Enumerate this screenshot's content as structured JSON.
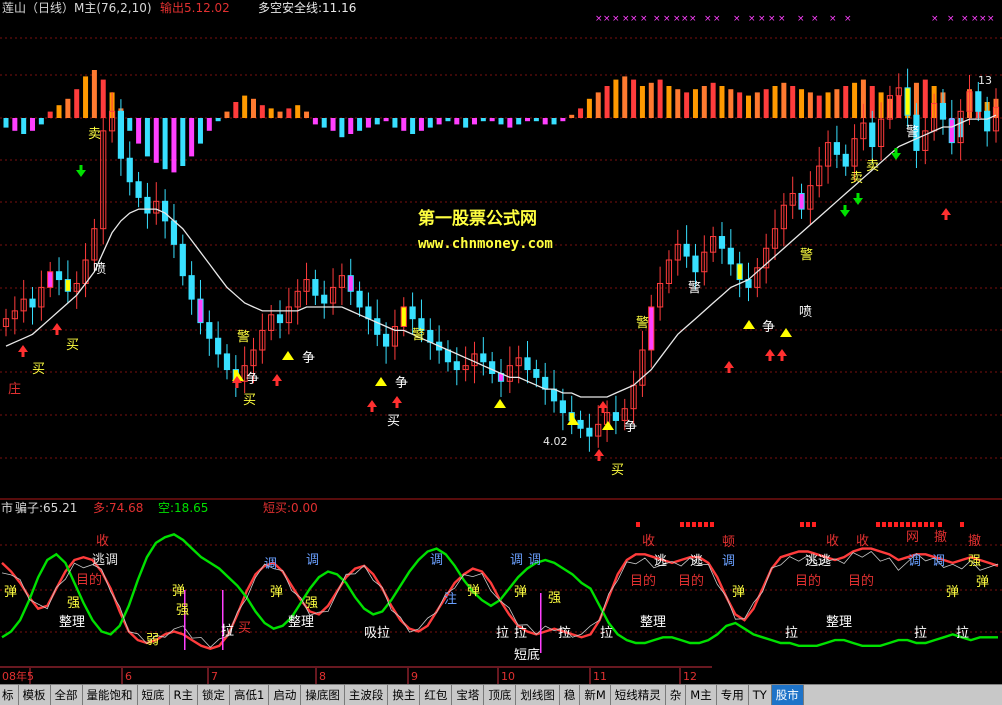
{
  "colors": {
    "bg": "#000000",
    "grid_red": "#7a1010",
    "up_red": "#ff3c3c",
    "down_cyan": "#38e0ff",
    "ma_white": "#e8e8e8",
    "yellow": "#ffff00",
    "magenta": "#ff40ff",
    "green": "#00e000",
    "orange": "#ff9a00",
    "label_red": "#e03030",
    "label_yellow": "#ffff40",
    "label_blue": "#6aa0ff"
  },
  "header": {
    "title": "莲山（日线）M主(76,2,10)",
    "output": "输出5.12.02",
    "safety_line": "多空安全线:11.16"
  },
  "watermark": {
    "line1": "第一股票公式网",
    "line2": "www.chnmoney.com"
  },
  "lower_header": {
    "name": "市",
    "v1": "骗子:65.21",
    "v2": "多:74.68",
    "v3": "空:18.65",
    "v4": "短买:0.00"
  },
  "price_labels": {
    "high": "13",
    "low": "4.02"
  },
  "chart_data": [
    {
      "type": "candlestick",
      "title": "莲山（日线）M主(76,2,10)",
      "close": [
        7.1,
        7.3,
        7.6,
        7.4,
        7.9,
        8.3,
        8.1,
        7.8,
        8.0,
        8.6,
        9.4,
        11.9,
        12.4,
        11.2,
        10.6,
        10.2,
        9.8,
        10.1,
        9.6,
        9.0,
        8.2,
        7.6,
        7.0,
        6.6,
        6.2,
        5.8,
        5.5,
        5.9,
        6.3,
        6.8,
        7.2,
        7.0,
        7.4,
        7.8,
        8.1,
        7.7,
        7.5,
        7.9,
        8.2,
        7.8,
        7.4,
        7.1,
        6.7,
        6.4,
        6.9,
        7.4,
        7.1,
        6.8,
        6.5,
        6.3,
        6.0,
        5.8,
        5.9,
        6.2,
        6.0,
        5.7,
        5.5,
        5.9,
        6.1,
        5.8,
        5.6,
        5.3,
        5.0,
        4.7,
        4.5,
        4.3,
        4.1,
        4.4,
        4.7,
        4.5,
        4.8,
        5.4,
        6.3,
        7.4,
        8.0,
        8.6,
        9.0,
        8.7,
        8.3,
        8.8,
        9.2,
        8.9,
        8.5,
        8.1,
        7.9,
        8.4,
        8.9,
        9.4,
        10.0,
        10.3,
        9.9,
        10.5,
        11.0,
        11.6,
        11.3,
        11.0,
        11.7,
        12.1,
        11.5,
        12.2,
        12.8,
        13.0,
        12.3,
        11.4,
        11.9,
        12.6,
        12.2,
        11.6,
        12.4,
        12.9,
        12.4,
        11.9,
        12.5
      ],
      "ma_safety_line": [
        6.4,
        6.5,
        6.6,
        6.7,
        6.9,
        7.1,
        7.3,
        7.5,
        7.7,
        8.0,
        8.3,
        8.8,
        9.3,
        9.6,
        9.8,
        9.9,
        9.9,
        9.9,
        9.8,
        9.6,
        9.4,
        9.1,
        8.8,
        8.5,
        8.2,
        7.9,
        7.7,
        7.5,
        7.4,
        7.3,
        7.3,
        7.3,
        7.3,
        7.3,
        7.4,
        7.4,
        7.4,
        7.4,
        7.4,
        7.3,
        7.2,
        7.1,
        7.0,
        6.9,
        6.8,
        6.8,
        6.7,
        6.6,
        6.5,
        6.4,
        6.3,
        6.2,
        6.1,
        6.0,
        5.9,
        5.8,
        5.7,
        5.6,
        5.6,
        5.5,
        5.4,
        5.3,
        5.3,
        5.2,
        5.2,
        5.1,
        5.1,
        5.1,
        5.1,
        5.2,
        5.3,
        5.4,
        5.6,
        5.8,
        6.1,
        6.4,
        6.7,
        6.9,
        7.1,
        7.3,
        7.5,
        7.7,
        7.9,
        8.0,
        8.1,
        8.3,
        8.5,
        8.7,
        8.9,
        9.1,
        9.3,
        9.5,
        9.7,
        9.9,
        10.1,
        10.3,
        10.5,
        10.7,
        10.9,
        11.1,
        11.3,
        11.5,
        11.6,
        11.7,
        11.8,
        11.9,
        12.0,
        12.0,
        12.1,
        12.2,
        12.2,
        12.2,
        12.3
      ],
      "annotations": [
        "卖",
        "喷",
        "买",
        "警",
        "争",
        "庄",
        "买",
        "买",
        "警",
        "争",
        "争",
        "买",
        "4.02",
        "争",
        "买",
        "警",
        "警",
        "争",
        "喷",
        "警",
        "卖",
        "卖",
        "警",
        "13"
      ],
      "momentum_bars": [
        -3,
        -4,
        -5,
        -4,
        -2,
        2,
        4,
        6,
        9,
        13,
        15,
        12,
        8,
        3,
        -4,
        -8,
        -12,
        -14,
        -16,
        -17,
        -15,
        -12,
        -8,
        -4,
        -1,
        2,
        5,
        7,
        6,
        4,
        3,
        2,
        3,
        4,
        2,
        -2,
        -3,
        -4,
        -6,
        -5,
        -4,
        -3,
        -2,
        -1,
        -3,
        -4,
        -5,
        -4,
        -3,
        -2,
        -1,
        -2,
        -3,
        -2,
        -1,
        -1,
        -2,
        -3,
        -2,
        -1,
        -1,
        -2,
        -2,
        -1,
        1,
        3,
        6,
        8,
        10,
        12,
        13,
        12,
        10,
        11,
        12,
        10,
        9,
        8,
        9,
        10,
        11,
        10,
        9,
        8,
        7,
        8,
        9,
        10,
        11,
        10,
        9,
        8,
        7,
        8,
        9,
        10,
        11,
        12,
        10,
        8,
        6,
        7,
        9,
        11,
        12,
        10,
        8,
        -4,
        -6,
        9,
        7,
        5,
        6
      ]
    },
    {
      "type": "line",
      "series": [
        {
          "name": "多",
          "values": [
            70,
            64,
            56,
            46,
            38,
            40,
            52,
            64,
            72,
            74,
            72,
            64,
            52,
            36,
            22,
            16,
            14,
            16,
            20,
            22,
            20,
            16,
            12,
            10,
            12,
            20,
            34,
            50,
            62,
            68,
            70,
            64,
            54,
            44,
            36,
            34,
            40,
            50,
            60,
            66,
            68,
            62,
            52,
            40,
            30,
            24,
            22,
            26,
            36,
            46,
            56,
            62,
            66,
            64,
            56,
            44,
            34,
            26,
            22,
            20,
            22,
            24,
            22,
            20,
            18,
            20,
            30,
            46,
            62,
            72,
            76,
            76,
            74,
            72,
            70,
            72,
            74,
            74,
            70,
            60,
            46,
            34,
            30,
            38,
            52,
            66,
            74,
            76,
            78,
            78,
            76,
            74,
            72,
            74,
            78,
            80,
            80,
            78,
            76,
            72,
            74,
            76,
            76,
            74,
            72,
            70,
            72,
            74,
            72,
            70,
            68
          ]
        },
        {
          "name": "空",
          "values": [
            18,
            22,
            30,
            44,
            60,
            72,
            76,
            70,
            56,
            42,
            30,
            22,
            20,
            26,
            40,
            58,
            74,
            84,
            88,
            90,
            86,
            80,
            74,
            70,
            66,
            60,
            54,
            46,
            36,
            28,
            24,
            26,
            32,
            42,
            52,
            60,
            64,
            62,
            56,
            46,
            38,
            34,
            36,
            44,
            54,
            64,
            72,
            78,
            80,
            76,
            68,
            58,
            50,
            44,
            40,
            44,
            52,
            60,
            66,
            70,
            72,
            70,
            66,
            62,
            56,
            52,
            40,
            28,
            20,
            16,
            14,
            14,
            16,
            18,
            18,
            16,
            14,
            14,
            16,
            20,
            26,
            28,
            24,
            20,
            18,
            16,
            14,
            14,
            12,
            12,
            12,
            14,
            16,
            16,
            14,
            12,
            12,
            12,
            14,
            16,
            16,
            14,
            14,
            16,
            18,
            20,
            18,
            16,
            18,
            18,
            18
          ]
        }
      ]
    }
  ],
  "x_axis": {
    "labels": [
      "08年5",
      "6",
      "7",
      "8",
      "9",
      "10",
      "11",
      "12"
    ]
  },
  "tabs": [
    {
      "label": "标",
      "active": false
    },
    {
      "label": "模板",
      "active": false
    },
    {
      "label": "全部",
      "active": false
    },
    {
      "label": "量能饱和",
      "active": false
    },
    {
      "label": "短底",
      "active": false
    },
    {
      "label": "R主",
      "active": false
    },
    {
      "label": "锁定",
      "active": false
    },
    {
      "label": "高低1",
      "active": false
    },
    {
      "label": "启动",
      "active": false
    },
    {
      "label": "操底图",
      "active": false
    },
    {
      "label": "主波段",
      "active": false
    },
    {
      "label": "换主",
      "active": false
    },
    {
      "label": "红包",
      "active": false
    },
    {
      "label": "宝塔",
      "active": false
    },
    {
      "label": "顶底",
      "active": false
    },
    {
      "label": "划线图",
      "active": false
    },
    {
      "label": "稳",
      "active": false
    },
    {
      "label": "新M",
      "active": false
    },
    {
      "label": "短线精灵",
      "active": false
    },
    {
      "label": "杂",
      "active": false
    },
    {
      "label": "M主",
      "active": false
    },
    {
      "label": "专用",
      "active": false
    },
    {
      "label": "TY",
      "active": false
    },
    {
      "label": "股市",
      "active": true
    }
  ],
  "lower_labels": {
    "items": [
      "收",
      "逃调",
      "目的",
      "弹",
      "强",
      "整理",
      "弱",
      "弹",
      "强",
      "拉",
      "买",
      "调",
      "弹",
      "强",
      "整理",
      "吸拉",
      "调",
      "注",
      "弹",
      "拉",
      "拉",
      "调",
      "调",
      "调",
      "弹",
      "拉",
      "强",
      "短底",
      "拉",
      "收",
      "逃",
      "目的",
      "整理",
      "顿",
      "逃",
      "调",
      "目的",
      "弹",
      "拉",
      "逃逃",
      "收",
      "目的",
      "整理",
      "拉",
      "网",
      "撤",
      "调",
      "拉",
      "撤",
      "调",
      "弹",
      "弹",
      "强",
      "收",
      "目的"
    ]
  }
}
